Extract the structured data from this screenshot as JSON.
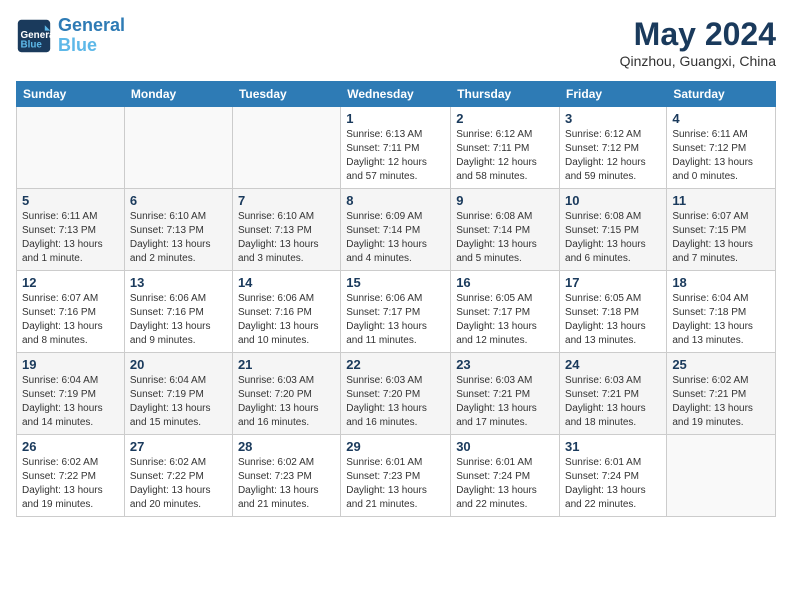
{
  "header": {
    "logo_line1": "General",
    "logo_line2": "Blue",
    "month_year": "May 2024",
    "location": "Qinzhou, Guangxi, China"
  },
  "weekdays": [
    "Sunday",
    "Monday",
    "Tuesday",
    "Wednesday",
    "Thursday",
    "Friday",
    "Saturday"
  ],
  "weeks": [
    [
      {
        "day": "",
        "info": ""
      },
      {
        "day": "",
        "info": ""
      },
      {
        "day": "",
        "info": ""
      },
      {
        "day": "1",
        "info": "Sunrise: 6:13 AM\nSunset: 7:11 PM\nDaylight: 12 hours and 57 minutes."
      },
      {
        "day": "2",
        "info": "Sunrise: 6:12 AM\nSunset: 7:11 PM\nDaylight: 12 hours and 58 minutes."
      },
      {
        "day": "3",
        "info": "Sunrise: 6:12 AM\nSunset: 7:12 PM\nDaylight: 12 hours and 59 minutes."
      },
      {
        "day": "4",
        "info": "Sunrise: 6:11 AM\nSunset: 7:12 PM\nDaylight: 13 hours and 0 minutes."
      }
    ],
    [
      {
        "day": "5",
        "info": "Sunrise: 6:11 AM\nSunset: 7:13 PM\nDaylight: 13 hours and 1 minute."
      },
      {
        "day": "6",
        "info": "Sunrise: 6:10 AM\nSunset: 7:13 PM\nDaylight: 13 hours and 2 minutes."
      },
      {
        "day": "7",
        "info": "Sunrise: 6:10 AM\nSunset: 7:13 PM\nDaylight: 13 hours and 3 minutes."
      },
      {
        "day": "8",
        "info": "Sunrise: 6:09 AM\nSunset: 7:14 PM\nDaylight: 13 hours and 4 minutes."
      },
      {
        "day": "9",
        "info": "Sunrise: 6:08 AM\nSunset: 7:14 PM\nDaylight: 13 hours and 5 minutes."
      },
      {
        "day": "10",
        "info": "Sunrise: 6:08 AM\nSunset: 7:15 PM\nDaylight: 13 hours and 6 minutes."
      },
      {
        "day": "11",
        "info": "Sunrise: 6:07 AM\nSunset: 7:15 PM\nDaylight: 13 hours and 7 minutes."
      }
    ],
    [
      {
        "day": "12",
        "info": "Sunrise: 6:07 AM\nSunset: 7:16 PM\nDaylight: 13 hours and 8 minutes."
      },
      {
        "day": "13",
        "info": "Sunrise: 6:06 AM\nSunset: 7:16 PM\nDaylight: 13 hours and 9 minutes."
      },
      {
        "day": "14",
        "info": "Sunrise: 6:06 AM\nSunset: 7:16 PM\nDaylight: 13 hours and 10 minutes."
      },
      {
        "day": "15",
        "info": "Sunrise: 6:06 AM\nSunset: 7:17 PM\nDaylight: 13 hours and 11 minutes."
      },
      {
        "day": "16",
        "info": "Sunrise: 6:05 AM\nSunset: 7:17 PM\nDaylight: 13 hours and 12 minutes."
      },
      {
        "day": "17",
        "info": "Sunrise: 6:05 AM\nSunset: 7:18 PM\nDaylight: 13 hours and 13 minutes."
      },
      {
        "day": "18",
        "info": "Sunrise: 6:04 AM\nSunset: 7:18 PM\nDaylight: 13 hours and 13 minutes."
      }
    ],
    [
      {
        "day": "19",
        "info": "Sunrise: 6:04 AM\nSunset: 7:19 PM\nDaylight: 13 hours and 14 minutes."
      },
      {
        "day": "20",
        "info": "Sunrise: 6:04 AM\nSunset: 7:19 PM\nDaylight: 13 hours and 15 minutes."
      },
      {
        "day": "21",
        "info": "Sunrise: 6:03 AM\nSunset: 7:20 PM\nDaylight: 13 hours and 16 minutes."
      },
      {
        "day": "22",
        "info": "Sunrise: 6:03 AM\nSunset: 7:20 PM\nDaylight: 13 hours and 16 minutes."
      },
      {
        "day": "23",
        "info": "Sunrise: 6:03 AM\nSunset: 7:21 PM\nDaylight: 13 hours and 17 minutes."
      },
      {
        "day": "24",
        "info": "Sunrise: 6:03 AM\nSunset: 7:21 PM\nDaylight: 13 hours and 18 minutes."
      },
      {
        "day": "25",
        "info": "Sunrise: 6:02 AM\nSunset: 7:21 PM\nDaylight: 13 hours and 19 minutes."
      }
    ],
    [
      {
        "day": "26",
        "info": "Sunrise: 6:02 AM\nSunset: 7:22 PM\nDaylight: 13 hours and 19 minutes."
      },
      {
        "day": "27",
        "info": "Sunrise: 6:02 AM\nSunset: 7:22 PM\nDaylight: 13 hours and 20 minutes."
      },
      {
        "day": "28",
        "info": "Sunrise: 6:02 AM\nSunset: 7:23 PM\nDaylight: 13 hours and 21 minutes."
      },
      {
        "day": "29",
        "info": "Sunrise: 6:01 AM\nSunset: 7:23 PM\nDaylight: 13 hours and 21 minutes."
      },
      {
        "day": "30",
        "info": "Sunrise: 6:01 AM\nSunset: 7:24 PM\nDaylight: 13 hours and 22 minutes."
      },
      {
        "day": "31",
        "info": "Sunrise: 6:01 AM\nSunset: 7:24 PM\nDaylight: 13 hours and 22 minutes."
      },
      {
        "day": "",
        "info": ""
      }
    ]
  ]
}
